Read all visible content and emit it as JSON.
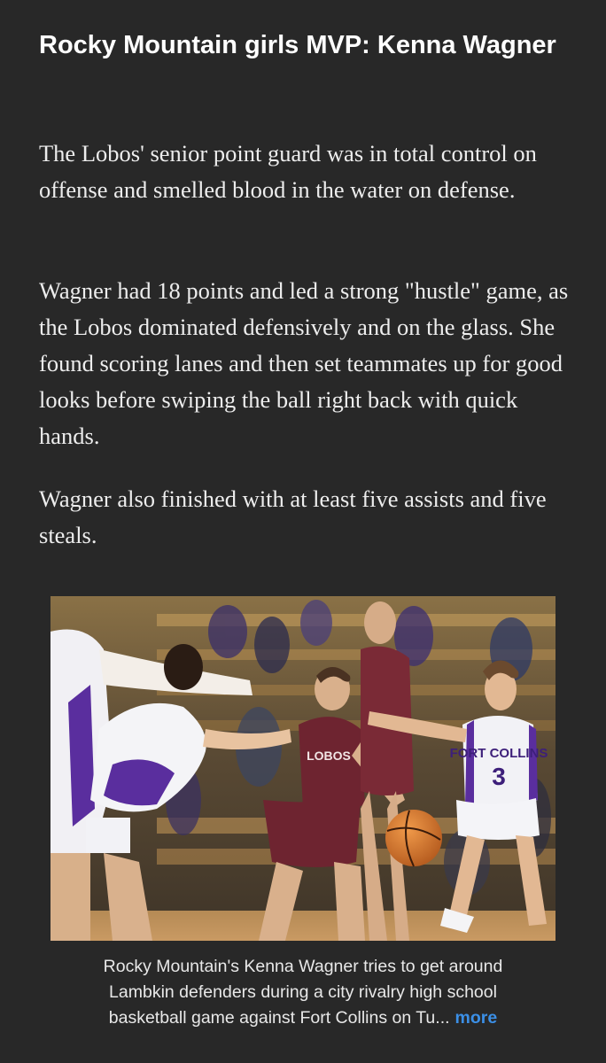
{
  "article": {
    "headline": "Rocky Mountain girls MVP: Kenna Wagner",
    "paragraphs": [
      "The Lobos' senior point guard was in total control on offense and smelled blood in the water on defense.",
      "Wagner had 18 points and led a strong \"hustle\" game, as the Lobos dominated defensively and on the glass.  She found scoring lanes and then set teammates up for good looks before swiping the ball right back with quick hands.",
      "Wagner also finished with at least five assists and five steals."
    ]
  },
  "photo": {
    "jersey_text_white": "FORT COLLINS",
    "jersey_number_white": "3",
    "jersey_text_maroon": "LOBOS"
  },
  "caption": {
    "lines": [
      "Rocky Mountain's Kenna Wagner tries to get around",
      "Lambkin defenders during a city rivalry high school",
      "basketball game against Fort Collins on Tu..."
    ],
    "more_label": "more"
  },
  "colors": {
    "background": "#282828",
    "link": "#3b8fe6",
    "lobos_maroon": "#6e2430",
    "lambkins_purple": "#5a2e9e"
  }
}
